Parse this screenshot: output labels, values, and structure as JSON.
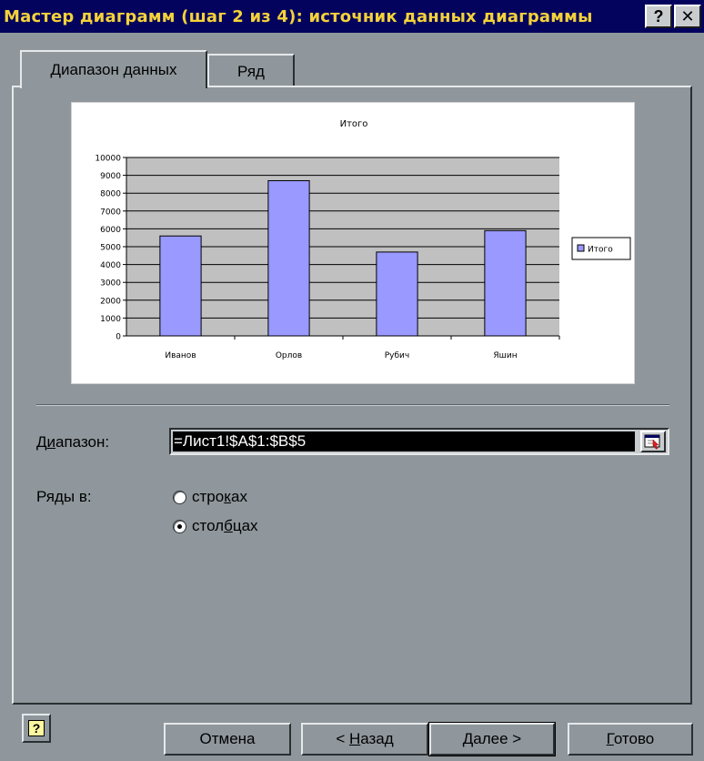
{
  "window": {
    "title": "Мастер диаграмм (шаг 2 из 4): источник данных диаграммы",
    "help_glyph": "?",
    "close_glyph": "✕"
  },
  "tabs": [
    {
      "label": "Диапазон данных",
      "active": true
    },
    {
      "label": "Ряд",
      "active": false
    }
  ],
  "chart_data": {
    "type": "bar",
    "title": "Итого",
    "categories": [
      "Иванов",
      "Орлов",
      "Рубич",
      "Яшин"
    ],
    "series": [
      {
        "name": "Итого",
        "values": [
          5600,
          8700,
          4700,
          5900
        ]
      }
    ],
    "ylim": [
      0,
      10000
    ],
    "yticks": [
      "10000",
      "9000",
      "8000",
      "7000",
      "6000",
      "5000",
      "4000",
      "3000",
      "2000",
      "1000",
      "0"
    ],
    "grid": true,
    "legend": "right",
    "bar_color": "#9999ff",
    "plot_bg": "#c0c0c0"
  },
  "range": {
    "label_prefix": "Д",
    "label_underlined": "и",
    "label_suffix": "апазон:",
    "value": "=Лист1!$A$1:$B$5"
  },
  "series_in": {
    "label": "Ряды в:",
    "options": [
      {
        "prefix": "стро",
        "underlined": "к",
        "suffix": "ах",
        "checked": false
      },
      {
        "prefix": "стол",
        "underlined": "б",
        "suffix": "цах",
        "checked": true
      }
    ]
  },
  "buttons": {
    "help_glyph": "?",
    "cancel": "Отмена",
    "back_prefix": "< ",
    "back_underlined": "Н",
    "back_suffix": "азад",
    "next": "Далее >",
    "finish_underlined": "Г",
    "finish_suffix": "отово"
  }
}
